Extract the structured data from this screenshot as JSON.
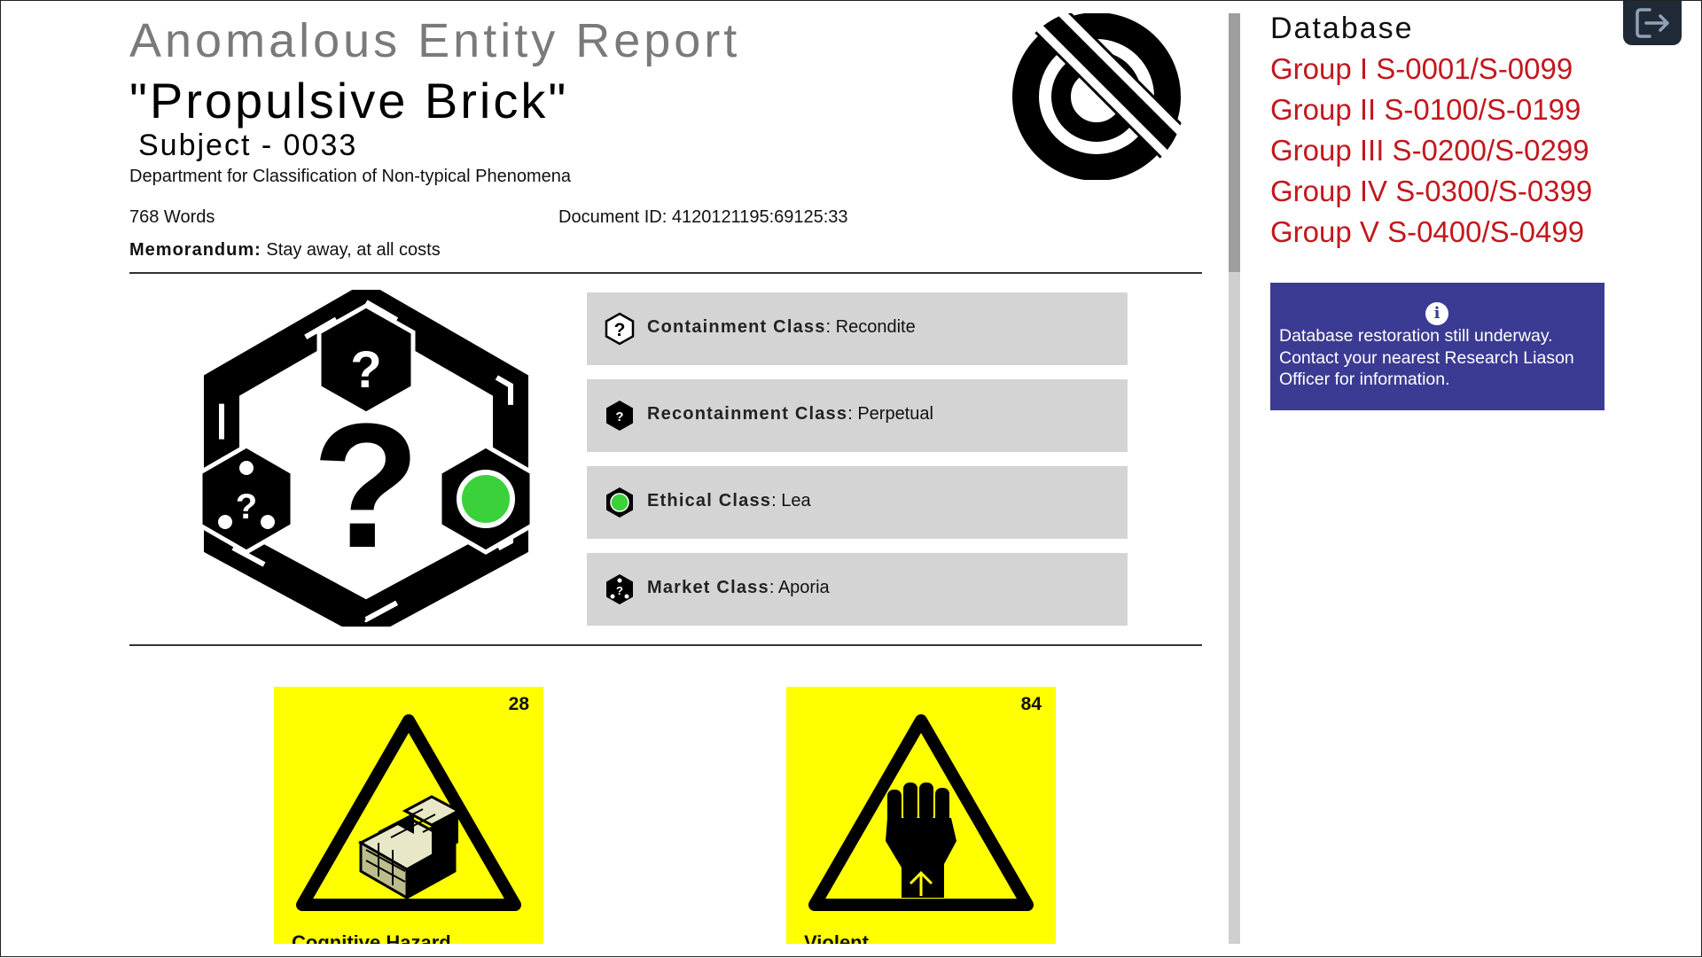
{
  "header": {
    "doc_title": "Anomalous Entity Report",
    "subject_name": "\"Propulsive Brick\"",
    "subject_id": "Subject - 0033",
    "department": "Department for Classification of Non-typical Phenomena",
    "word_count": "768 Words",
    "document_id": "Document ID: 4120121195:69125:33",
    "memo_label": "Memorandum:",
    "memo_text": " Stay away, at all costs"
  },
  "classes": [
    {
      "label": "Containment Class",
      "value": ": Recondite",
      "icon": "question-hex-outline-icon"
    },
    {
      "label": "Recontainment Class",
      "value": ": Perpetual",
      "icon": "question-hex-filled-icon"
    },
    {
      "label": "Ethical Class",
      "value": ": Lea",
      "icon": "green-dot-hex-icon"
    },
    {
      "label": "Market Class",
      "value": ": Aporia",
      "icon": "dots-question-hex-icon"
    }
  ],
  "hazards": [
    {
      "number": "28",
      "caption": "Cognitive Hazard",
      "icon": "impossible-brick-warning-icon"
    },
    {
      "number": "84",
      "caption": "Violent",
      "icon": "raised-fist-warning-icon"
    }
  ],
  "sidebar": {
    "title": "Database",
    "links": [
      "Group I S-0001/S-0099",
      "Group II S-0100/S-0199",
      "Group III S-0200/S-0299",
      "Group IV S-0300/S-0399",
      "Group V S-0400/S-0499"
    ],
    "notice": "Database restoration still underway. Contact your nearest Research Liason Officer for information."
  },
  "colors": {
    "accent_link": "#c2181e",
    "notice_bg": "#3b3b93",
    "hazard_bg": "#ffff00",
    "ethical_green": "#3bd13b",
    "class_box_bg": "#d4d4d4"
  }
}
